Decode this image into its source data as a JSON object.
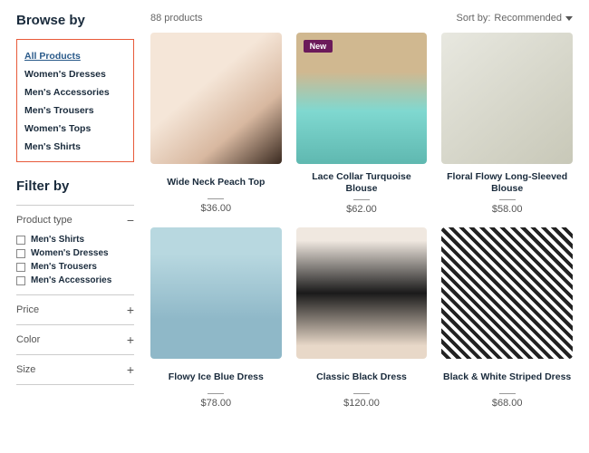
{
  "sidebar": {
    "browse_title": "Browse by",
    "categories": [
      {
        "label": "All Products",
        "active": true
      },
      {
        "label": "Women's Dresses",
        "active": false
      },
      {
        "label": "Men's Accessories",
        "active": false
      },
      {
        "label": "Men's Trousers",
        "active": false
      },
      {
        "label": "Women's Tops",
        "active": false
      },
      {
        "label": "Men's Shirts",
        "active": false
      }
    ],
    "filter_title": "Filter by",
    "filters": {
      "product_type": {
        "label": "Product type",
        "expanded": true,
        "options": [
          "Men's Shirts",
          "Women's Dresses",
          "Men's Trousers",
          "Men's Accessories"
        ]
      },
      "price": {
        "label": "Price",
        "expanded": false
      },
      "color": {
        "label": "Color",
        "expanded": false
      },
      "size": {
        "label": "Size",
        "expanded": false
      }
    }
  },
  "main": {
    "count_text": "88 products",
    "sort_label": "Sort by:",
    "sort_value": "Recommended",
    "products": [
      {
        "name": "Wide Neck Peach Top",
        "price": "$36.00",
        "badge": null
      },
      {
        "name": "Lace Collar Turquoise Blouse",
        "price": "$62.00",
        "badge": "New"
      },
      {
        "name": "Floral Flowy Long-Sleeved Blouse",
        "price": "$58.00",
        "badge": null
      },
      {
        "name": "Flowy Ice Blue Dress",
        "price": "$78.00",
        "badge": null
      },
      {
        "name": "Classic Black Dress",
        "price": "$120.00",
        "badge": null
      },
      {
        "name": "Black & White Striped Dress",
        "price": "$68.00",
        "badge": null
      }
    ]
  }
}
